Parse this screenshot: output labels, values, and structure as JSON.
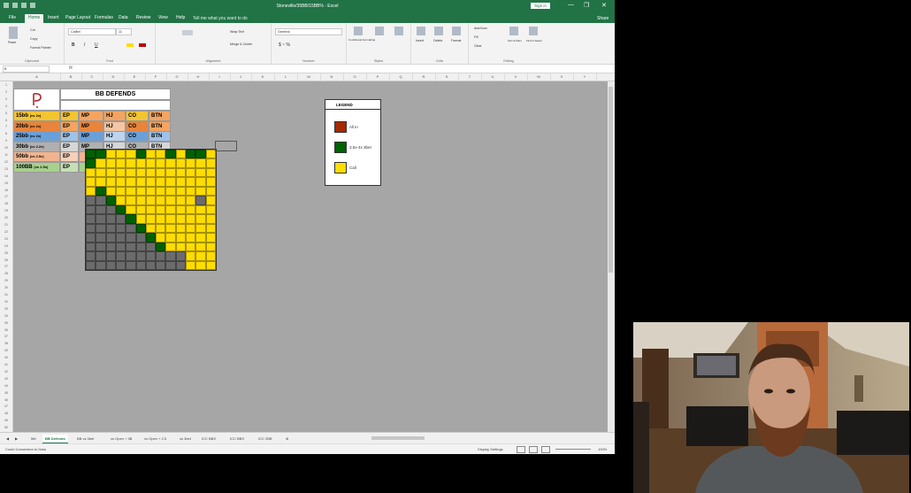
{
  "window": {
    "title": "Stoneville/35BB/15BB% - Excel",
    "sign_in": "Sign in",
    "minimize": "—",
    "restore": "❐",
    "close": "✕"
  },
  "ribbon_tabs": [
    "File",
    "Home",
    "Insert",
    "Page Layout",
    "Formulas",
    "Data",
    "Review",
    "View",
    "Help"
  ],
  "active_tab": "Home",
  "tell_me": "Tell me what you want to do",
  "share": "Share",
  "ribbon": {
    "clipboard": {
      "paste": "Paste",
      "cut": "Cut",
      "copy": "Copy",
      "format_painter": "Format Painter",
      "label": "Clipboard"
    },
    "font": {
      "name": "Calibri",
      "size": "11",
      "label": "Font"
    },
    "alignment": {
      "wrap": "Wrap Text",
      "merge": "Merge & Center",
      "label": "Alignment"
    },
    "number": {
      "format": "General",
      "label": "Number"
    },
    "styles": {
      "conditional": "Conditional Formatting",
      "format_table": "Format as Table",
      "cell_styles": "Cell Styles",
      "label": "Styles"
    },
    "cells": {
      "insert": "Insert",
      "delete": "Delete",
      "format": "Format",
      "label": "Cells"
    },
    "editing": {
      "autosum": "AutoSum",
      "fill": "Fill",
      "clear": "Clear",
      "sort": "Sort & Filter",
      "find": "Find & Select",
      "label": "Editing"
    }
  },
  "formula_bar": {
    "name_box": "K",
    "fx": "fx",
    "value": ""
  },
  "columns": [
    "A",
    "B",
    "C",
    "D",
    "E",
    "F",
    "G",
    "H",
    "I",
    "J",
    "K",
    "L",
    "M",
    "N",
    "O",
    "P",
    "Q",
    "R",
    "S",
    "T",
    "U",
    "V",
    "W",
    "X",
    "Y"
  ],
  "rows": [
    "1",
    "2",
    "3",
    "4",
    "5",
    "6",
    "7",
    "8",
    "9",
    "10",
    "11",
    "12",
    "13",
    "14",
    "15",
    "16",
    "17",
    "18",
    "19",
    "20",
    "21",
    "22",
    "23",
    "24",
    "25",
    "26",
    "27",
    "28",
    "29",
    "30",
    "31",
    "32",
    "33",
    "34",
    "35",
    "36",
    "37",
    "38",
    "39",
    "40",
    "41",
    "42",
    "43",
    "44",
    "45",
    "46",
    "47",
    "48",
    "49",
    "50"
  ],
  "bb_table": {
    "header": "BB DEFENDS",
    "rows": [
      {
        "stack": "15bb",
        "sub": "(vs 2x)",
        "color": "#f4c430",
        "pos": [
          "EP",
          "MP",
          "HJ",
          "CO",
          "BTN"
        ],
        "pc": [
          "#f4c430",
          "#f4a460",
          "#f4a460",
          "#f4c430",
          "#f4a460"
        ]
      },
      {
        "stack": "20bb",
        "sub": "(vs 2x)",
        "color": "#e9843a",
        "pos": [
          "EP",
          "MP",
          "HJ",
          "CO",
          "BTN"
        ],
        "pc": [
          "#f4a460",
          "#e9843a",
          "#f4c6a5",
          "#e9843a",
          "#f4a460"
        ]
      },
      {
        "stack": "25bb",
        "sub": "(vs 2x)",
        "color": "#6aa0d9",
        "pos": [
          "EP",
          "MP",
          "HJ",
          "CO",
          "BTN"
        ],
        "pc": [
          "#9fc2e8",
          "#6aa0d9",
          "#bcd4ef",
          "#6aa0d9",
          "#9fc2e8"
        ]
      },
      {
        "stack": "30bb",
        "sub": "(vs 2.2x)",
        "color": "#b0b0b0",
        "pos": [
          "EP",
          "MP",
          "HJ",
          "CO",
          "BTN"
        ],
        "pc": [
          "#d6d6d6",
          "#b0b0b0",
          "#d6d6d6",
          "#b0b0b0",
          "#d6d6d6"
        ]
      },
      {
        "stack": "50bb",
        "sub": "(vs 2.5x)",
        "color": "#f2b48f",
        "pos": [
          "EP",
          "",
          ""
        ],
        "pc": [
          "#f7d0b8",
          "#f2b48f",
          "#f2b48f"
        ]
      },
      {
        "stack": "100BB",
        "sub": "(vs 2.5x)",
        "color": "#a8d08d",
        "pos": [
          "EP",
          "",
          ""
        ],
        "pc": [
          "#c6e0b4",
          "#a8d08d",
          "#a8d08d"
        ]
      }
    ]
  },
  "legend": {
    "title": "LEGEND",
    "items": [
      {
        "label": "All in",
        "color": "#a52a00"
      },
      {
        "label": "3.5x-4x 3bet",
        "color": "#006100"
      },
      {
        "label": "Call",
        "color": "#ffdd00"
      }
    ]
  },
  "sheet_tabs": [
    "Mtt",
    "BB Defends",
    "BB vs 3bet",
    "vs Open + 3B",
    "vs Open + 2.5",
    "vs 3bet",
    "ICC BBS",
    "ICC BBS",
    "ICC 2BB"
  ],
  "active_sheet": "BB Defends",
  "status": {
    "left": "Could Connection to Data",
    "display": "Display Settings",
    "zoom": "100%"
  }
}
